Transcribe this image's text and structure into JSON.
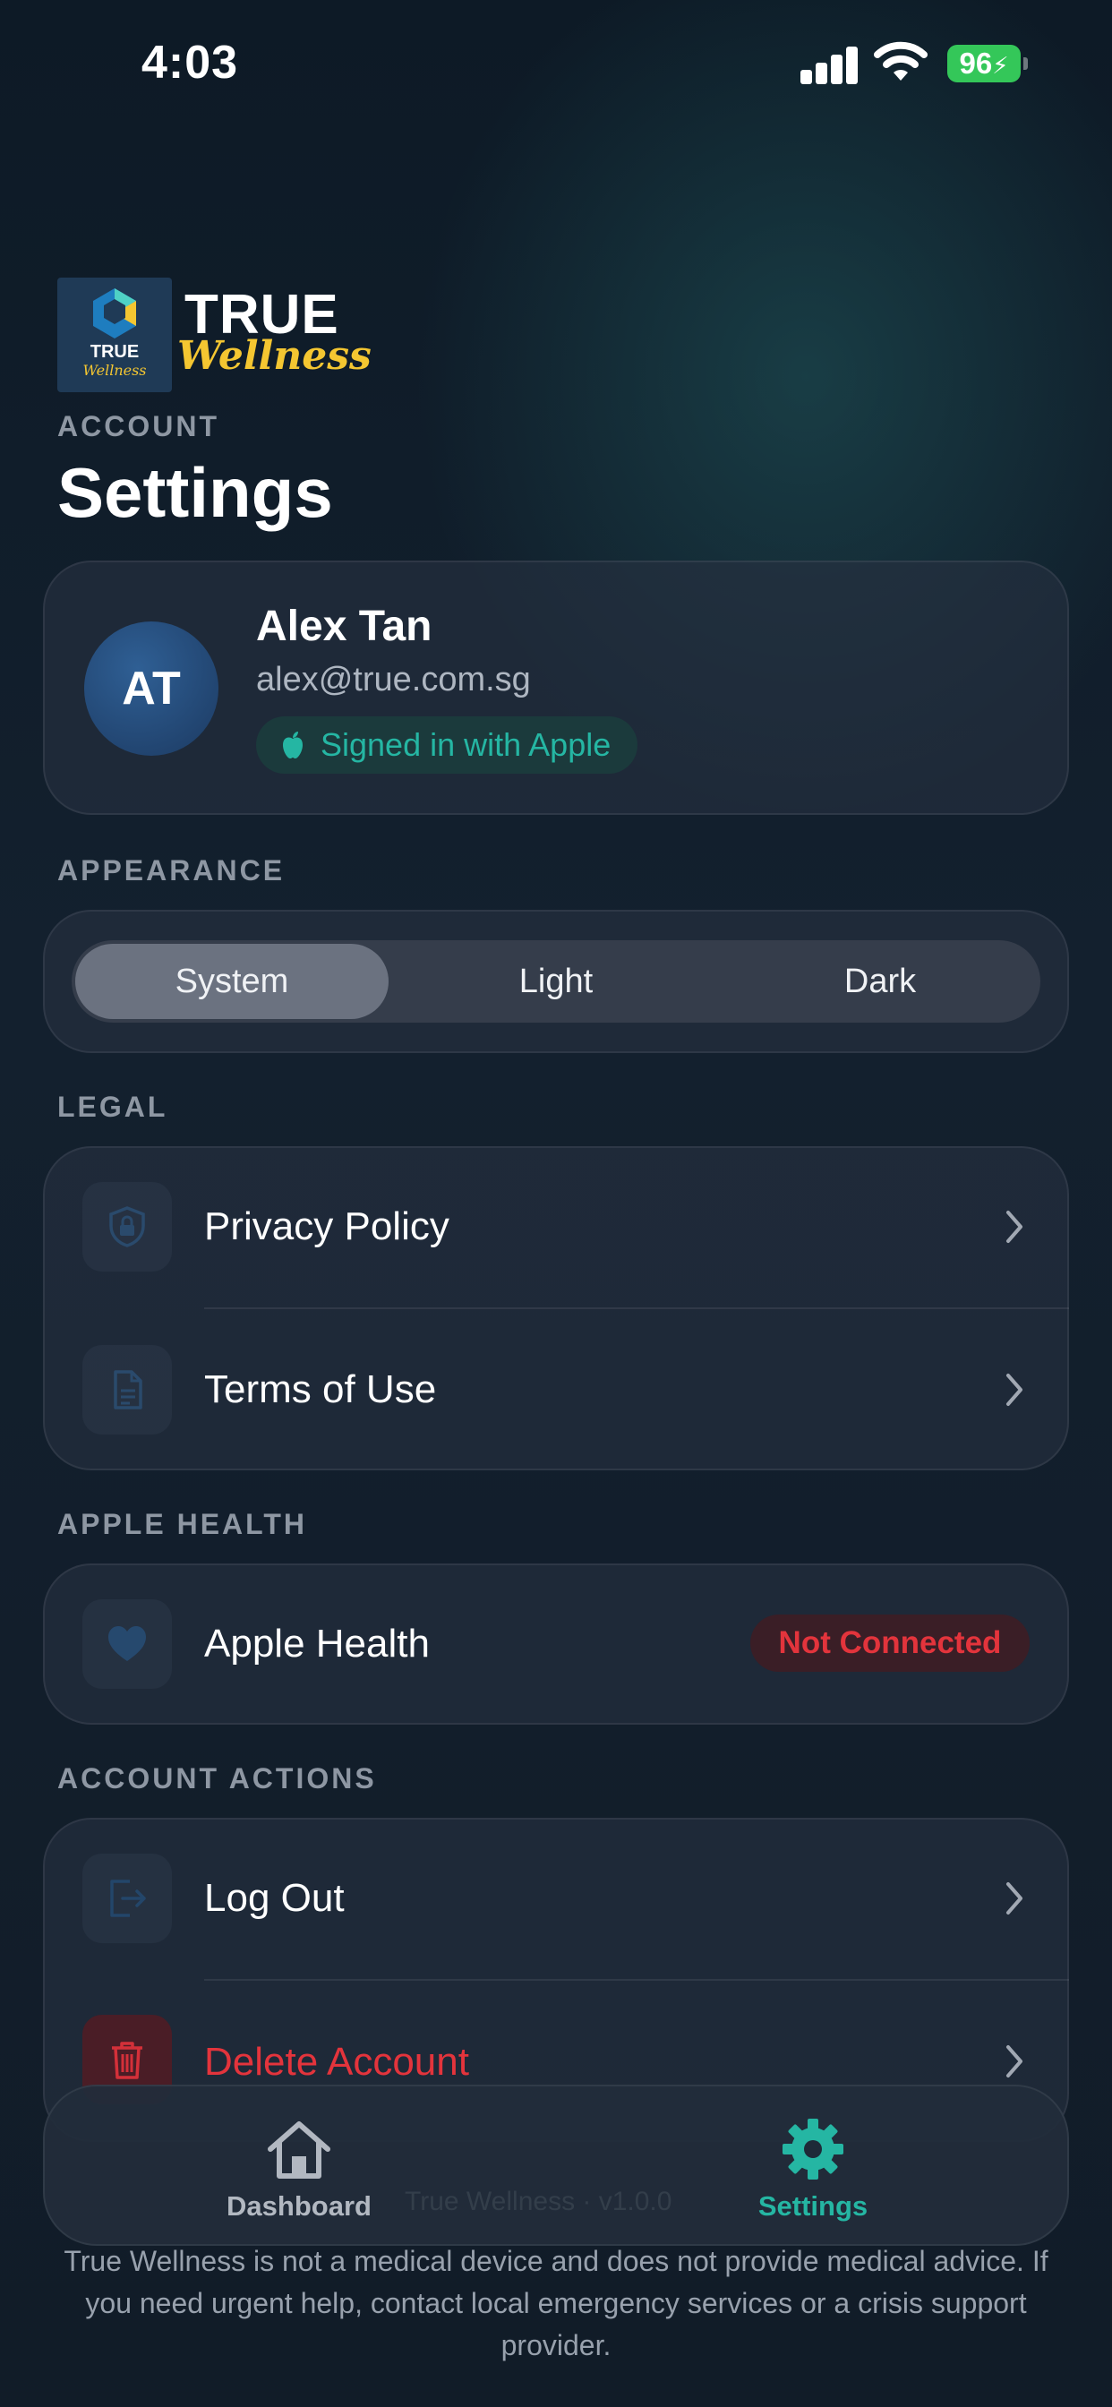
{
  "status_bar": {
    "time": "4:03",
    "battery": "96"
  },
  "brand": {
    "logo_mark_word": "TRUE",
    "logo_mark_script": "Wellness",
    "word_top": "TRUE",
    "word_script": "Wellness"
  },
  "header": {
    "section": "ACCOUNT",
    "title": "Settings"
  },
  "profile": {
    "initials": "AT",
    "name": "Alex Tan",
    "email": "alex@true.com.sg",
    "badge": "Signed in with Apple"
  },
  "appearance": {
    "label": "APPEARANCE",
    "options": [
      "System",
      "Light",
      "Dark"
    ],
    "selected": "System"
  },
  "legal": {
    "label": "LEGAL",
    "items": [
      {
        "label": "Privacy Policy",
        "icon": "shield-lock-icon"
      },
      {
        "label": "Terms of Use",
        "icon": "document-icon"
      }
    ]
  },
  "apple_health": {
    "label": "APPLE HEALTH",
    "item": "Apple Health",
    "icon": "heart-icon",
    "status": "Not Connected"
  },
  "account_actions": {
    "label": "ACCOUNT ACTIONS",
    "items": [
      {
        "label": "Log Out",
        "icon": "logout-icon"
      },
      {
        "label": "Delete Account",
        "icon": "trash-icon"
      }
    ]
  },
  "tabs": [
    {
      "label": "Dashboard",
      "icon": "home-icon",
      "active": false
    },
    {
      "label": "Settings",
      "icon": "gear-icon",
      "active": true
    }
  ],
  "footer": {
    "version": "True Wellness · v1.0.0",
    "disclaimer": "True Wellness is not a medical device and does not provide medical advice. If you need urgent help, contact local emergency services or a crisis support provider."
  },
  "colors": {
    "accent": "#25b6a3",
    "danger": "#e3343c",
    "brand_yellow": "#f4c631"
  }
}
